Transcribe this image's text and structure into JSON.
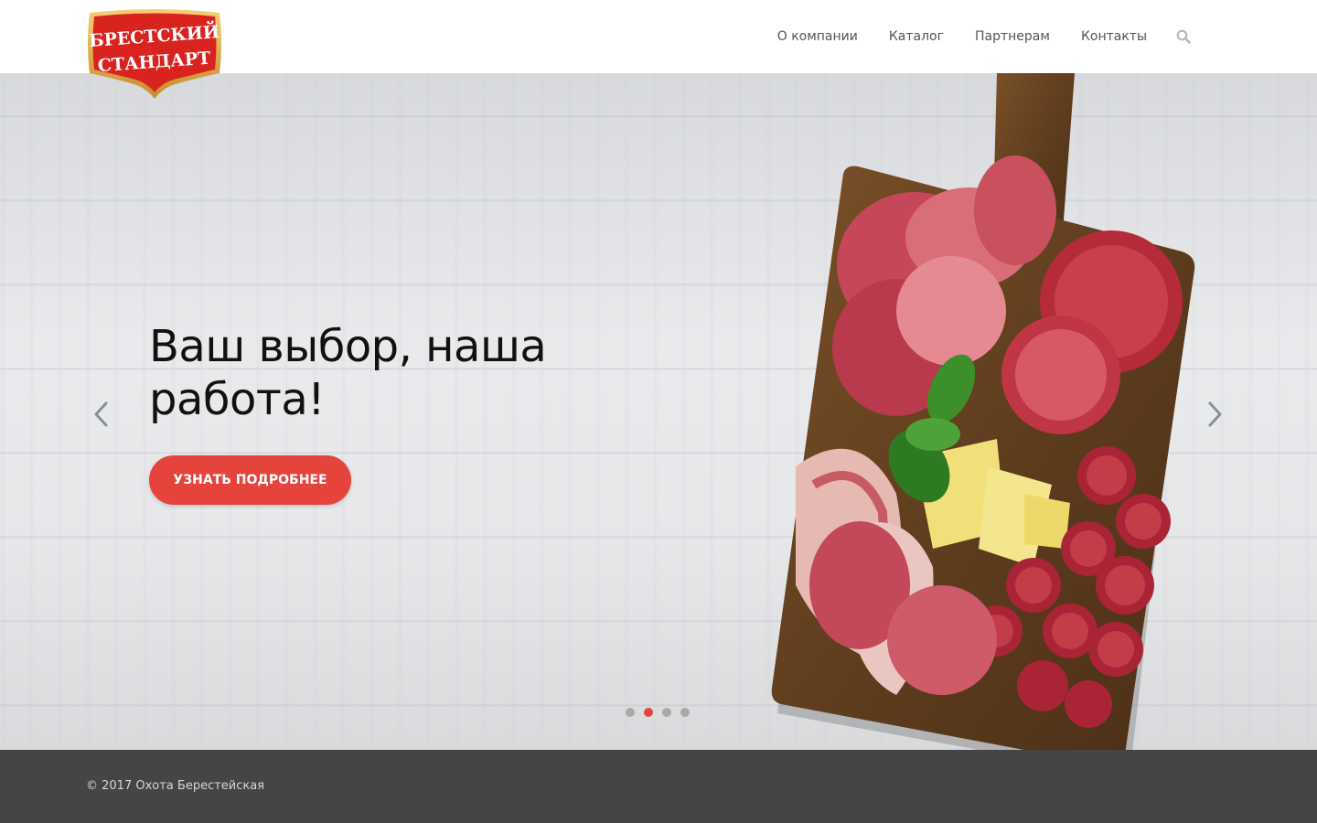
{
  "brand": {
    "logo_line1": "БРЕСТСКИЙ",
    "logo_line2": "СТАНДАРТ",
    "colors": {
      "logo_red": "#d8231f",
      "logo_gold": "#e8b54a"
    }
  },
  "nav": {
    "items": [
      {
        "label": "О компании"
      },
      {
        "label": "Каталог"
      },
      {
        "label": "Партнерам"
      },
      {
        "label": "Контакты"
      }
    ],
    "search_icon": "search-icon"
  },
  "hero": {
    "headline": "Ваш выбор, наша работа!",
    "cta_label": "УЗНАТЬ ПОДРОБНЕЕ",
    "slides_count": 4,
    "active_slide": 2,
    "prev_icon": "chevron-left-icon",
    "next_icon": "chevron-right-icon"
  },
  "footer": {
    "copyright": "© 2017 Охота Берестейская"
  },
  "colors": {
    "accent": "#e5443c",
    "footer_bg": "#454545",
    "nav_text": "#555555"
  }
}
